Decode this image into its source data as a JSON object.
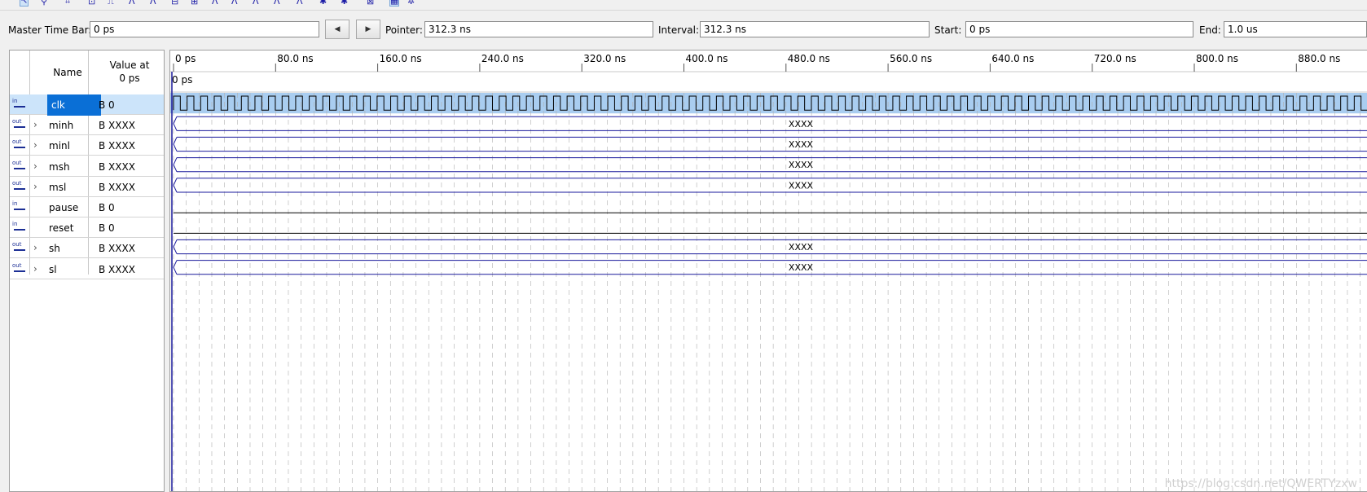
{
  "toolbar": {
    "icons": [
      "pointer-tool-icon",
      "zoom-tool-icon",
      "node-finder-icon",
      "insert-node-icon",
      "waveform-icon",
      "force-high-icon",
      "force-low-icon",
      "invert-icon",
      "count-value-icon",
      "random-value-icon",
      "clock-icon",
      "arbitrary-value-icon",
      "overwrite-icon",
      "snap-grid-icon",
      "run-functional-icon",
      "run-timing-icon",
      "generate-icon",
      "grid-toggle-icon",
      "settings-icon"
    ]
  },
  "timebar": {
    "master_label": "Master Time Bar:",
    "master_value": "0 ps",
    "prev_label": "◀",
    "next_label": "▶",
    "pointer_label": "Pointer:",
    "pointer_value": "312.3 ns",
    "interval_label": "Interval:",
    "interval_value": "312.3 ns",
    "start_label": "Start:",
    "start_value": "0 ps",
    "end_label": "End:",
    "end_value": "1.0 us"
  },
  "table": {
    "name_header": "Name",
    "value_header_1": "Value at",
    "value_header_2": "0 ps",
    "signals": [
      {
        "name": "clk",
        "value": "B 0",
        "dir": "in",
        "expandable": false,
        "selected": true,
        "wave": "clock"
      },
      {
        "name": "minh",
        "value": "B XXXX",
        "dir": "out",
        "expandable": true,
        "selected": false,
        "wave": "bus"
      },
      {
        "name": "minl",
        "value": "B XXXX",
        "dir": "out",
        "expandable": true,
        "selected": false,
        "wave": "bus"
      },
      {
        "name": "msh",
        "value": "B XXXX",
        "dir": "out",
        "expandable": true,
        "selected": false,
        "wave": "bus"
      },
      {
        "name": "msl",
        "value": "B XXXX",
        "dir": "out",
        "expandable": true,
        "selected": false,
        "wave": "bus"
      },
      {
        "name": "pause",
        "value": "B 0",
        "dir": "in",
        "expandable": false,
        "selected": false,
        "wave": "low"
      },
      {
        "name": "reset",
        "value": "B 0",
        "dir": "in",
        "expandable": false,
        "selected": false,
        "wave": "low"
      },
      {
        "name": "sh",
        "value": "B XXXX",
        "dir": "out",
        "expandable": true,
        "selected": false,
        "wave": "bus"
      },
      {
        "name": "sl",
        "value": "B XXXX",
        "dir": "out",
        "expandable": true,
        "selected": false,
        "wave": "bus"
      }
    ]
  },
  "waveform": {
    "time_ticks": [
      "0 ps",
      "80.0 ns",
      "160.0 ns",
      "240.0 ns",
      "320.0 ns",
      "400.0 ns",
      "480.0 ns",
      "560.0 ns",
      "640.0 ns",
      "720.0 ns",
      "800.0 ns",
      "880.0 ns"
    ],
    "cursor_label": "0 ps",
    "bus_value_label": "XXXX",
    "clock_cycles": 88,
    "colors": {
      "wave": "#1a1a9c",
      "grid": "#b0b0b0",
      "selected_row": "#a9cdf0",
      "tick_text": "#000000"
    }
  },
  "watermark": "https://blog.csdn.net/QWERTYzxw"
}
